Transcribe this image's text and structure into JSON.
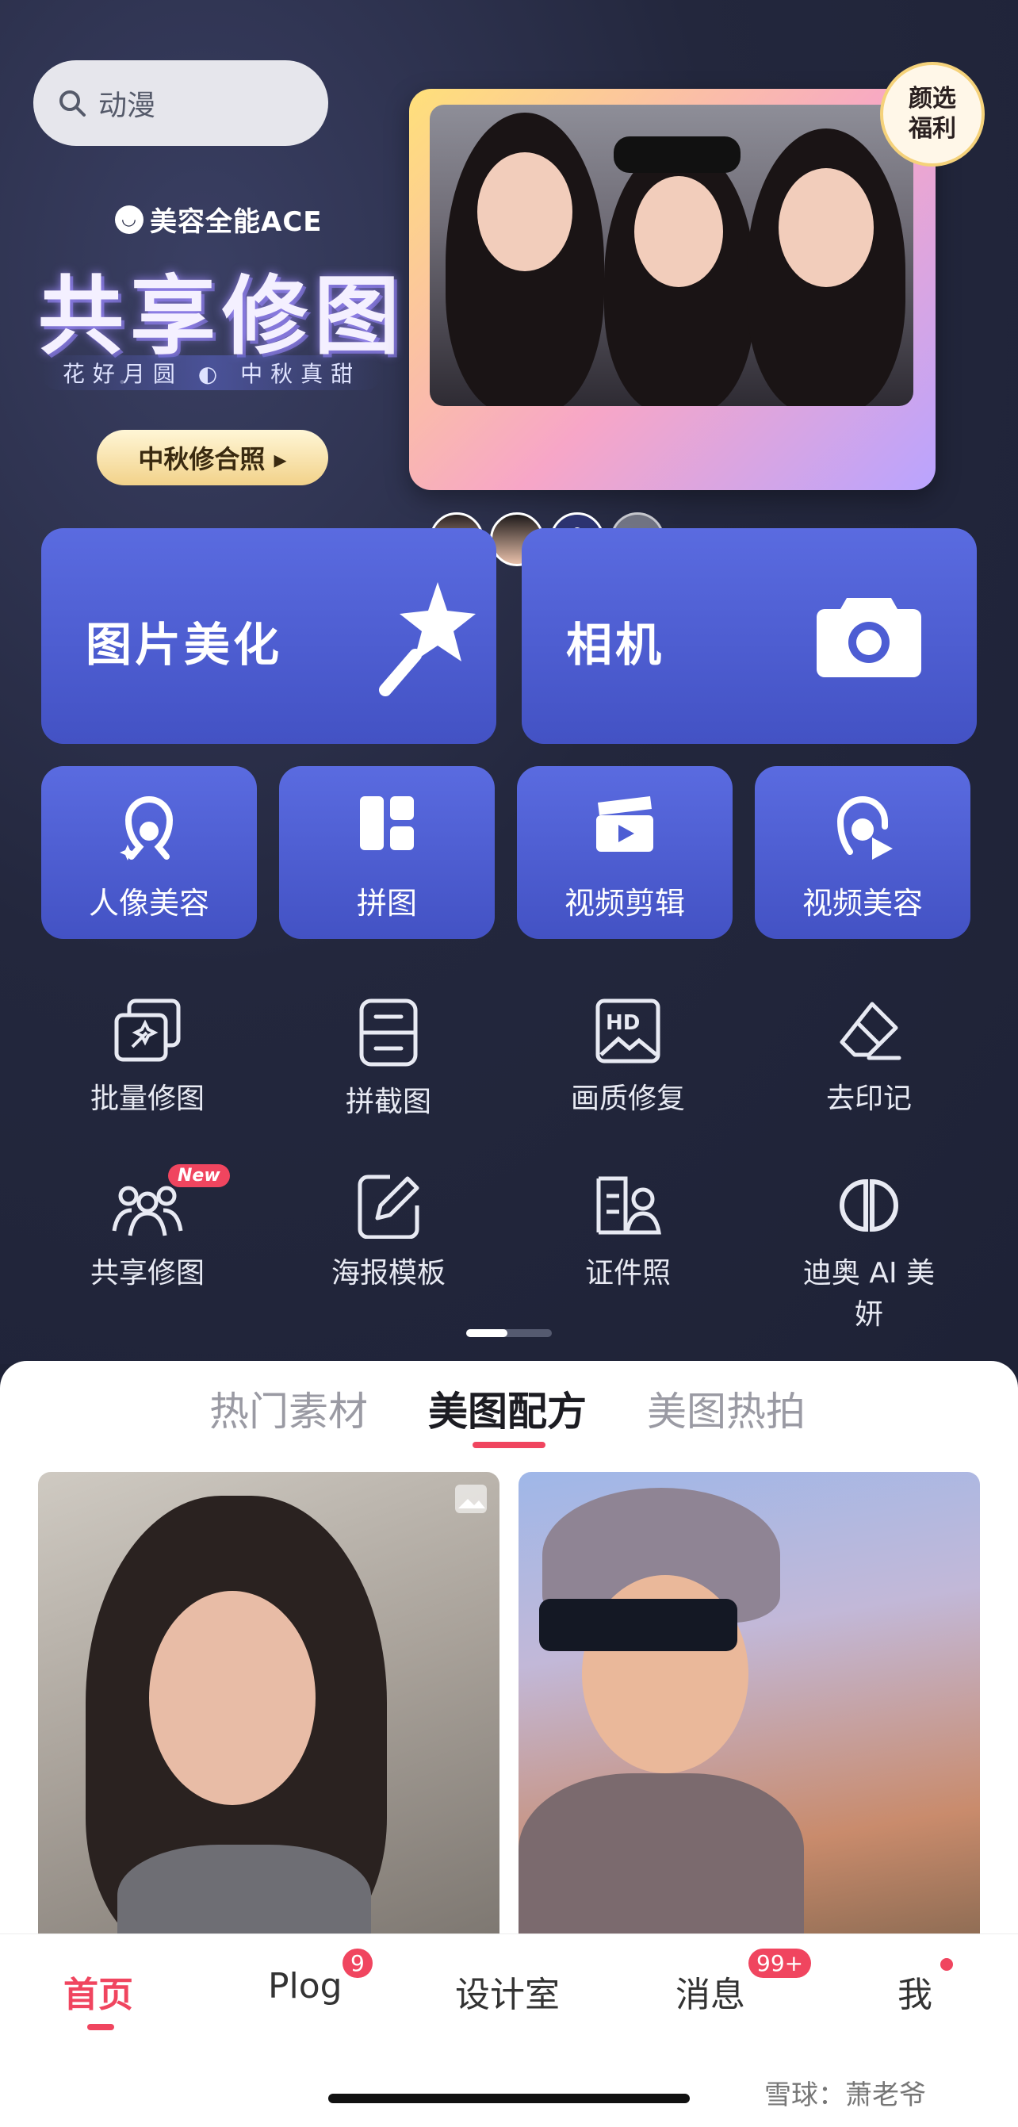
{
  "search": {
    "placeholder": "动漫"
  },
  "banner": {
    "brand": "美容全能ACE",
    "headline": "共享修图",
    "tagline": "花好月圆 ◐ 中秋真甜",
    "cta": "中秋修合照 ▸",
    "badge_line1": "颜选",
    "badge_line2": "福利"
  },
  "primary_tiles": [
    {
      "label": "图片美化",
      "icon": "magic-wand-icon"
    },
    {
      "label": "相机",
      "icon": "camera-icon"
    }
  ],
  "secondary_tiles": [
    {
      "label": "人像美容",
      "icon": "face-sparkle-icon"
    },
    {
      "label": "拼图",
      "icon": "collage-icon"
    },
    {
      "label": "视频剪辑",
      "icon": "clapperboard-icon"
    },
    {
      "label": "视频美容",
      "icon": "video-face-icon"
    }
  ],
  "tools": [
    {
      "label": "批量修图",
      "icon": "batch-edit-icon"
    },
    {
      "label": "拼截图",
      "icon": "screenshot-stitch-icon"
    },
    {
      "label": "画质修复",
      "icon": "hd-icon"
    },
    {
      "label": "去印记",
      "icon": "eraser-icon"
    },
    {
      "label": "共享修图",
      "icon": "shared-edit-icon",
      "tag": "New"
    },
    {
      "label": "海报模板",
      "icon": "poster-edit-icon"
    },
    {
      "label": "证件照",
      "icon": "id-photo-icon"
    },
    {
      "label": "迪奥 AI 美妍",
      "icon": "dior-logo-icon"
    }
  ],
  "content_tabs": [
    "热门素材",
    "美图配方",
    "美图热拍"
  ],
  "active_content_tab": "美图配方",
  "bottom_nav": [
    {
      "label": "首页",
      "active": true
    },
    {
      "label": "Plog",
      "badge": "9"
    },
    {
      "label": "设计室"
    },
    {
      "label": "消息",
      "badge": "99+"
    },
    {
      "label": "我",
      "dot": true
    }
  ],
  "watermark": "雪球：萧老爷",
  "colors": {
    "accent": "#f0455f",
    "tile": "#4d5dd3",
    "background": "#1e2236"
  }
}
